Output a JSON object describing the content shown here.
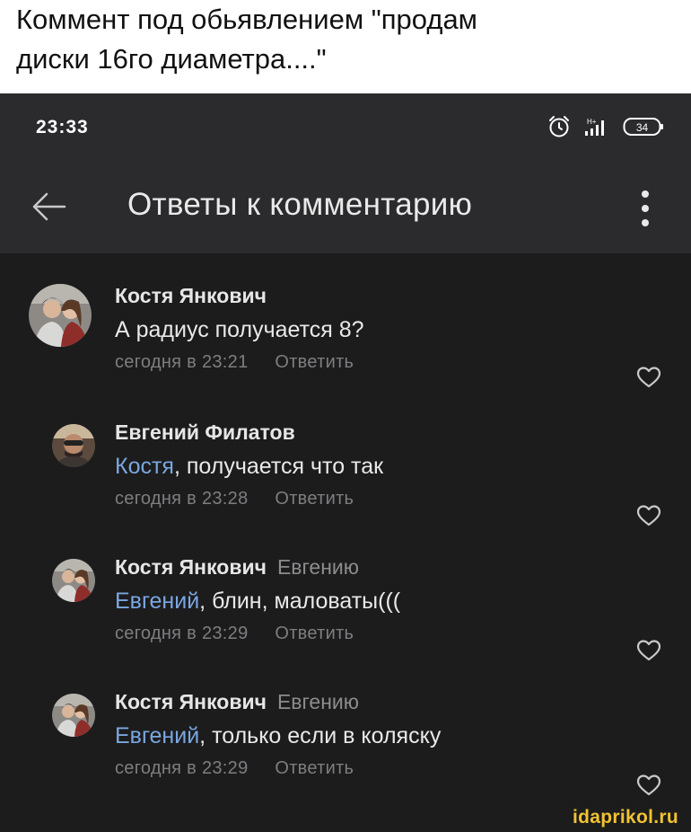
{
  "caption": {
    "line1": "Коммент под обьявлением \"продам",
    "line2": "диски 16го диаметра....\""
  },
  "status_bar": {
    "time": "23:33",
    "network_label": "H+",
    "battery_level": "34",
    "icons": [
      "alarm-clock-icon",
      "signal-icon",
      "battery-icon"
    ]
  },
  "app_bar": {
    "title": "Ответы к комментарию",
    "icons": [
      "back-arrow-icon",
      "more-vertical-icon"
    ]
  },
  "comments": [
    {
      "author": "Костя Янкович",
      "reply_to": "",
      "mention": "",
      "text": "А радиус получается 8?",
      "time": "сегодня в 23:21",
      "reply_label": "Ответить"
    },
    {
      "author": "Евгений Филатов",
      "reply_to": "",
      "mention": "Костя",
      "text": ", получается что так",
      "time": "сегодня в 23:28",
      "reply_label": "Ответить"
    },
    {
      "author": "Костя Янкович",
      "reply_to": "Евгению",
      "mention": "Евгений",
      "text": ", блин, маловаты(((",
      "time": "сегодня в 23:29",
      "reply_label": "Ответить"
    },
    {
      "author": "Костя Янкович",
      "reply_to": "Евгению",
      "mention": "Евгений",
      "text": ", только если в коляску",
      "time": "сегодня в 23:29",
      "reply_label": "Ответить"
    }
  ],
  "watermark": "idaprikol.ru",
  "colors": {
    "background": "#1c1c1d",
    "app_bar": "#2b2b2d",
    "mention": "#7aa7e0",
    "secondary_text": "#7e7e80",
    "watermark": "#f2c230"
  }
}
